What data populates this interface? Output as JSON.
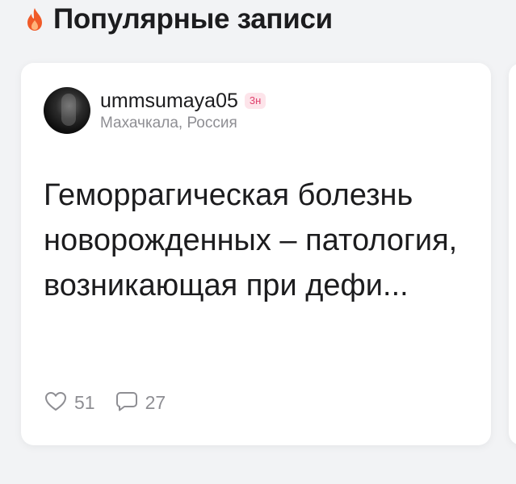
{
  "section": {
    "icon": "fire-icon",
    "title": "Популярные записи"
  },
  "post": {
    "author": {
      "username": "ummsumaya05",
      "time_badge": "3н",
      "location": "Махачкала, Россия"
    },
    "text": "Геморрагическая болезнь новорожденных – патология, возникающая при дефи...",
    "likes": "51",
    "comments": "27"
  },
  "colors": {
    "accent_fire": "#f05a28",
    "badge_bg": "#fde4ea",
    "badge_text": "#e0426e",
    "muted": "#8e8e93"
  }
}
